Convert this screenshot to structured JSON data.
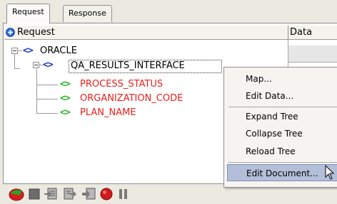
{
  "tabs": [
    {
      "label": "Request",
      "active": true
    },
    {
      "label": "Response",
      "active": false
    }
  ],
  "header": {
    "tree_label": "Request",
    "tree_icon": "add-circle-icon",
    "data_label": "Data"
  },
  "tree": {
    "root": {
      "tag": "<>",
      "label": "ORACLE"
    },
    "child": {
      "tag": "<>",
      "label": "QA_RESULTS_INTERFACE"
    },
    "leaves": [
      {
        "tag": "<>",
        "label": "PROCESS_STATUS"
      },
      {
        "tag": "<>",
        "label": "ORGANIZATION_CODE"
      },
      {
        "tag": "<>",
        "label": "PLAN_NAME"
      }
    ]
  },
  "context_menu": {
    "items": [
      {
        "label": "Map..."
      },
      {
        "label": "Edit Data..."
      },
      {
        "label": "Expand Tree"
      },
      {
        "label": "Collapse Tree"
      },
      {
        "label": "Reload Tree"
      },
      {
        "label": "Edit Document...",
        "highlighted": true
      }
    ]
  },
  "toolbar": {
    "icons": [
      "run-icon",
      "stop-icon",
      "import-icon",
      "export-icon",
      "insert-icon",
      "record-icon",
      "pause-icon"
    ]
  },
  "colors": {
    "tag_blue": "#1838c8",
    "tag_green": "#26b226",
    "leaf_text": "#e8201a",
    "menu_highlight": "#b3bfd9"
  }
}
